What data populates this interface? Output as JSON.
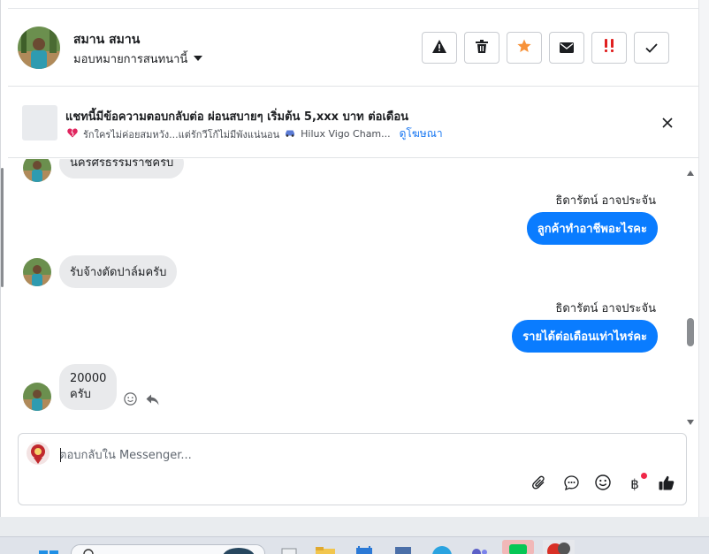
{
  "header": {
    "contact_name": "สมาน สมาน",
    "assign_label": "มอบหมายการสนทนานี้",
    "actions": [
      {
        "icon": "warning-icon",
        "color": "#1c1e21"
      },
      {
        "icon": "trash-icon",
        "color": "#1c1e21"
      },
      {
        "icon": "star-icon",
        "color": "#f7923a"
      },
      {
        "icon": "envelope-icon",
        "color": "#1c1e21"
      },
      {
        "icon": "double-exclamation-icon",
        "color": "#e02020"
      },
      {
        "icon": "check-icon",
        "color": "#1c1e21"
      }
    ]
  },
  "ad": {
    "title": "แชทนี้มีข้อความตอบกลับต่อ ผ่อนสบายๆ เริ่มต้น 5,xxx บาท ต่อเดือน",
    "snippet": "รักใครไม่ค่อยสมหวัง...แต่รักวีโก้ไม่มีพังแน่นอน",
    "snippet_car": "Hilux Vigo Cham...",
    "link": "ดูโฆษณา"
  },
  "messages": [
    {
      "direction": "in",
      "text": "นครศรีธรรมราชครับ"
    },
    {
      "direction": "out",
      "sender": "ธิดารัตน์ อาจประจัน",
      "text": "ลูกค้าทำอาชีพอะไรคะ"
    },
    {
      "direction": "in",
      "text": "รับจ้างตัดปาล์มครับ"
    },
    {
      "direction": "out",
      "sender": "ธิดารัตน์ อาจประจัน",
      "text": "รายได้ต่อเดือนเท่าไหร่คะ"
    },
    {
      "direction": "in",
      "line1": "20000",
      "line2": "ครับ"
    }
  ],
  "composer": {
    "placeholder": "ตอบกลับใน Messenger..."
  },
  "colors": {
    "accent": "#0a7cff",
    "link": "#1877f2",
    "incoming_bubble": "#e9eaec"
  }
}
